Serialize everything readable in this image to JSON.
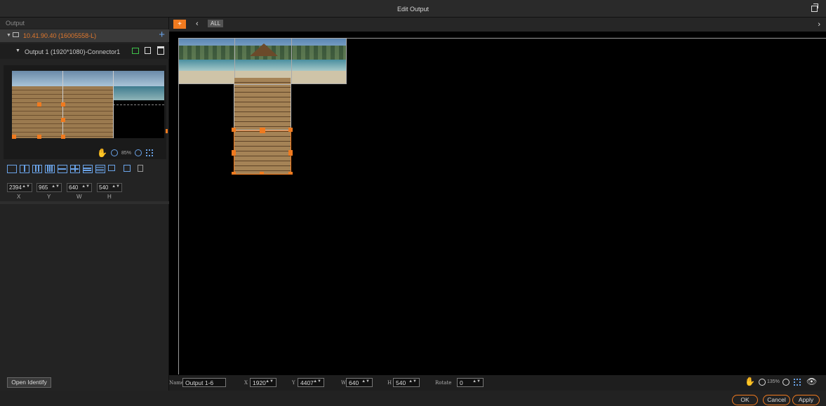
{
  "window": {
    "title": "Edit Output"
  },
  "left_panel": {
    "header": "Output",
    "device": {
      "name": "10.41.90.40  (16005558-L)"
    },
    "output": {
      "name": "Output 1 (1920*1080)-Connector1"
    },
    "preview_zoom": "85%",
    "fields": [
      {
        "label": "X",
        "value": "2394"
      },
      {
        "label": "Y",
        "value": "965"
      },
      {
        "label": "W",
        "value": "640"
      },
      {
        "label": "H",
        "value": "540"
      }
    ],
    "open_identify": "Open Identify"
  },
  "canvas_toolbar": {
    "add": "+",
    "all": "ALL"
  },
  "properties": {
    "name_label": "Name",
    "name_value": "Output 1-6",
    "x_label": "X",
    "x_value": "1920",
    "y_label": "Y",
    "y_value": "4407",
    "w_label": "W",
    "w_value": "640",
    "h_label": "H",
    "h_value": "540",
    "rotate_label": "Rotate",
    "rotate_value": "0",
    "zoom": "135%"
  },
  "footer": {
    "ok": "OK",
    "cancel": "Cancel",
    "apply": "Apply"
  },
  "icons": [
    "restore-icon",
    "monitor-icon",
    "plus-icon",
    "display-icon",
    "edit-icon",
    "delete-icon",
    "hand-icon",
    "zoom-out-icon",
    "zoom-in-icon",
    "fit-icon",
    "eye-icon"
  ],
  "colors": {
    "accent": "#f07a1f",
    "blue": "#6aa3e8",
    "green": "#3fc24a"
  }
}
